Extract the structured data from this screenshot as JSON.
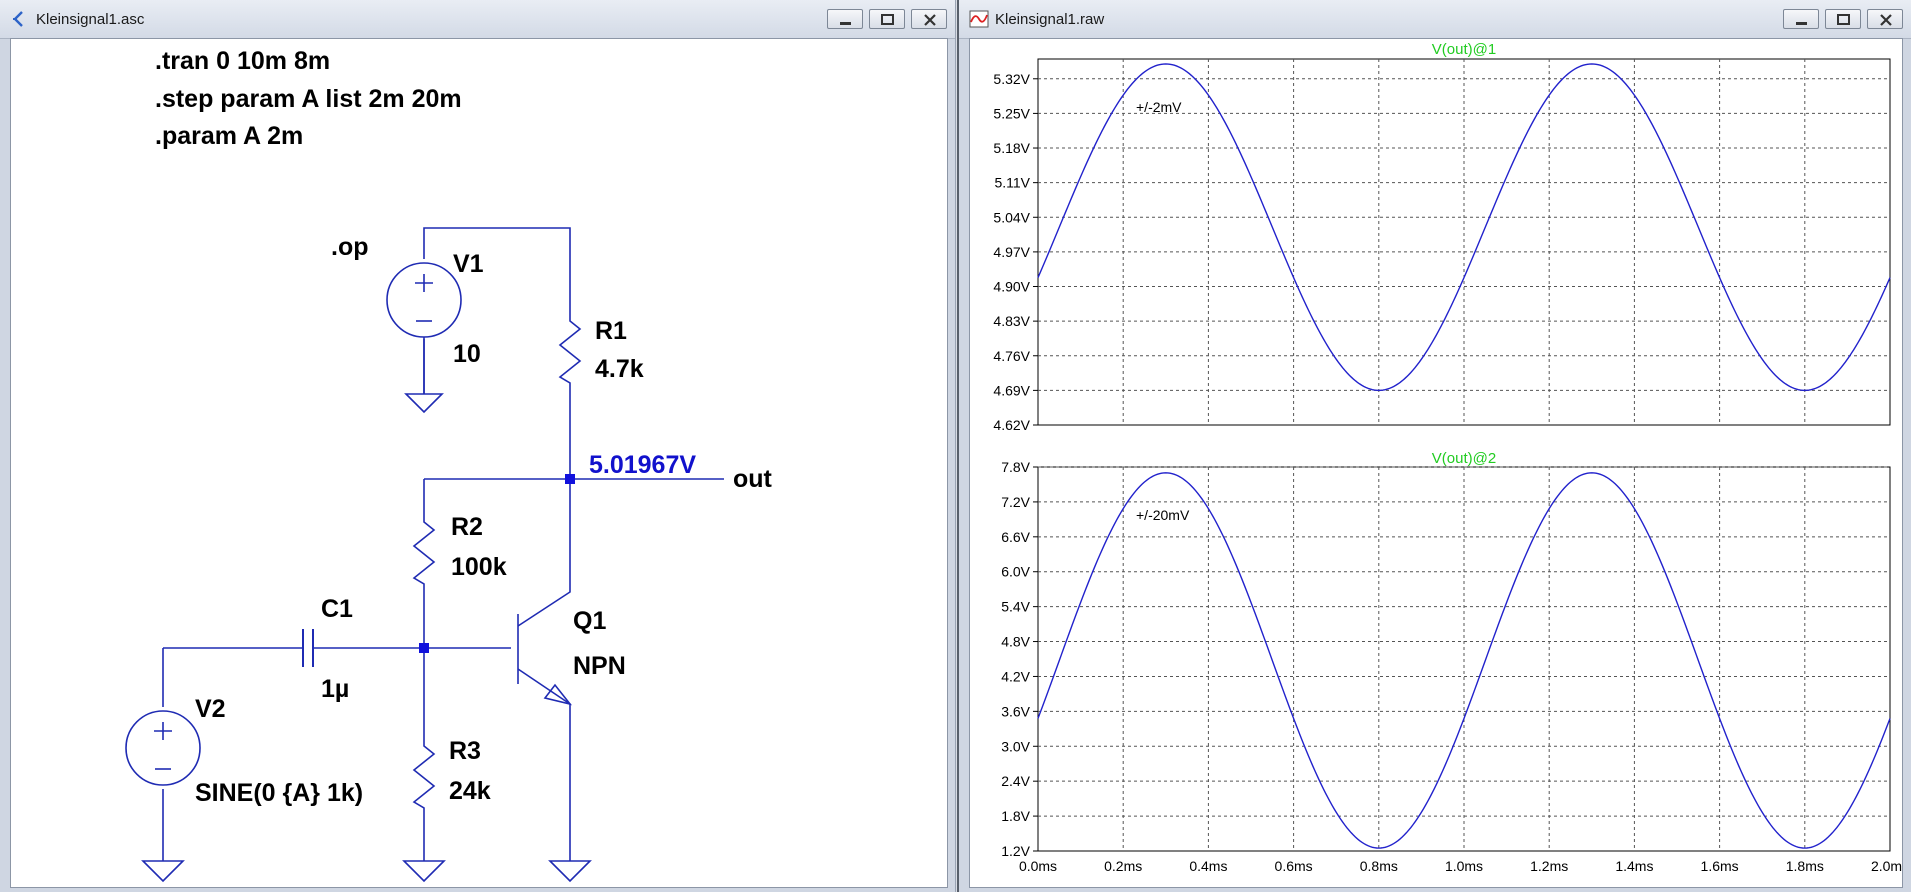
{
  "schematic_window": {
    "title": "Kleinsignal1.asc",
    "directives": [
      ".tran 0 10m 8m",
      ".step param A list 2m 20m",
      ".param A 2m"
    ],
    "op_label": ".op",
    "components": {
      "V1": {
        "name": "V1",
        "value": "10"
      },
      "R1": {
        "name": "R1",
        "value": "4.7k"
      },
      "R2": {
        "name": "R2",
        "value": "100k"
      },
      "R3": {
        "name": "R3",
        "value": "24k"
      },
      "C1": {
        "name": "C1",
        "value": "1µ"
      },
      "Q1": {
        "name": "Q1",
        "value": "NPN"
      },
      "V2": {
        "name": "V2",
        "value": "SINE(0 {A} 1k)"
      }
    },
    "node_voltage": "5.01967V",
    "net_label": "out",
    "colors": {
      "wire": "#1f2bb3",
      "voltage_label": "#1111cc",
      "junction": "#1111dd"
    }
  },
  "waveform_window": {
    "title": "Kleinsignal1.raw",
    "colors": {
      "trace": "#2222cc",
      "plot_title": "#22cc22"
    }
  },
  "chart_data": [
    {
      "type": "line",
      "title": "V(out)@1",
      "annotation": "+/-2mV",
      "x_unit": "ms",
      "xlim": [
        0,
        2
      ],
      "ylim": [
        4.62,
        5.36
      ],
      "x_ticks": [
        "0.0ms",
        "0.2ms",
        "0.4ms",
        "0.6ms",
        "0.8ms",
        "1.0ms",
        "1.2ms",
        "1.4ms",
        "1.6ms",
        "1.8ms",
        "2.0ms"
      ],
      "y_ticks": [
        "4.62V",
        "4.69V",
        "4.76V",
        "4.83V",
        "4.90V",
        "4.97V",
        "5.04V",
        "5.11V",
        "5.18V",
        "5.25V",
        "5.32V"
      ],
      "series": [
        {
          "name": "V(out)@1",
          "offset": 5.02,
          "amplitude": 0.33,
          "frequency_khz": 1,
          "phase_ms": -0.05
        }
      ]
    },
    {
      "type": "line",
      "title": "V(out)@2",
      "annotation": "+/-20mV",
      "x_unit": "ms",
      "xlim": [
        0,
        2
      ],
      "ylim": [
        1.2,
        7.8
      ],
      "x_ticks": [
        "0.0ms",
        "0.2ms",
        "0.4ms",
        "0.6ms",
        "0.8ms",
        "1.0ms",
        "1.2ms",
        "1.4ms",
        "1.6ms",
        "1.8ms",
        "2.0ms"
      ],
      "y_ticks": [
        "1.2V",
        "1.8V",
        "2.4V",
        "3.0V",
        "3.6V",
        "4.2V",
        "4.8V",
        "5.4V",
        "6.0V",
        "6.6V",
        "7.2V",
        "7.8V"
      ],
      "series": [
        {
          "name": "V(out)@2",
          "offset": 4.475,
          "amplitude": 3.225,
          "frequency_khz": 1,
          "phase_ms": -0.05
        }
      ]
    }
  ]
}
